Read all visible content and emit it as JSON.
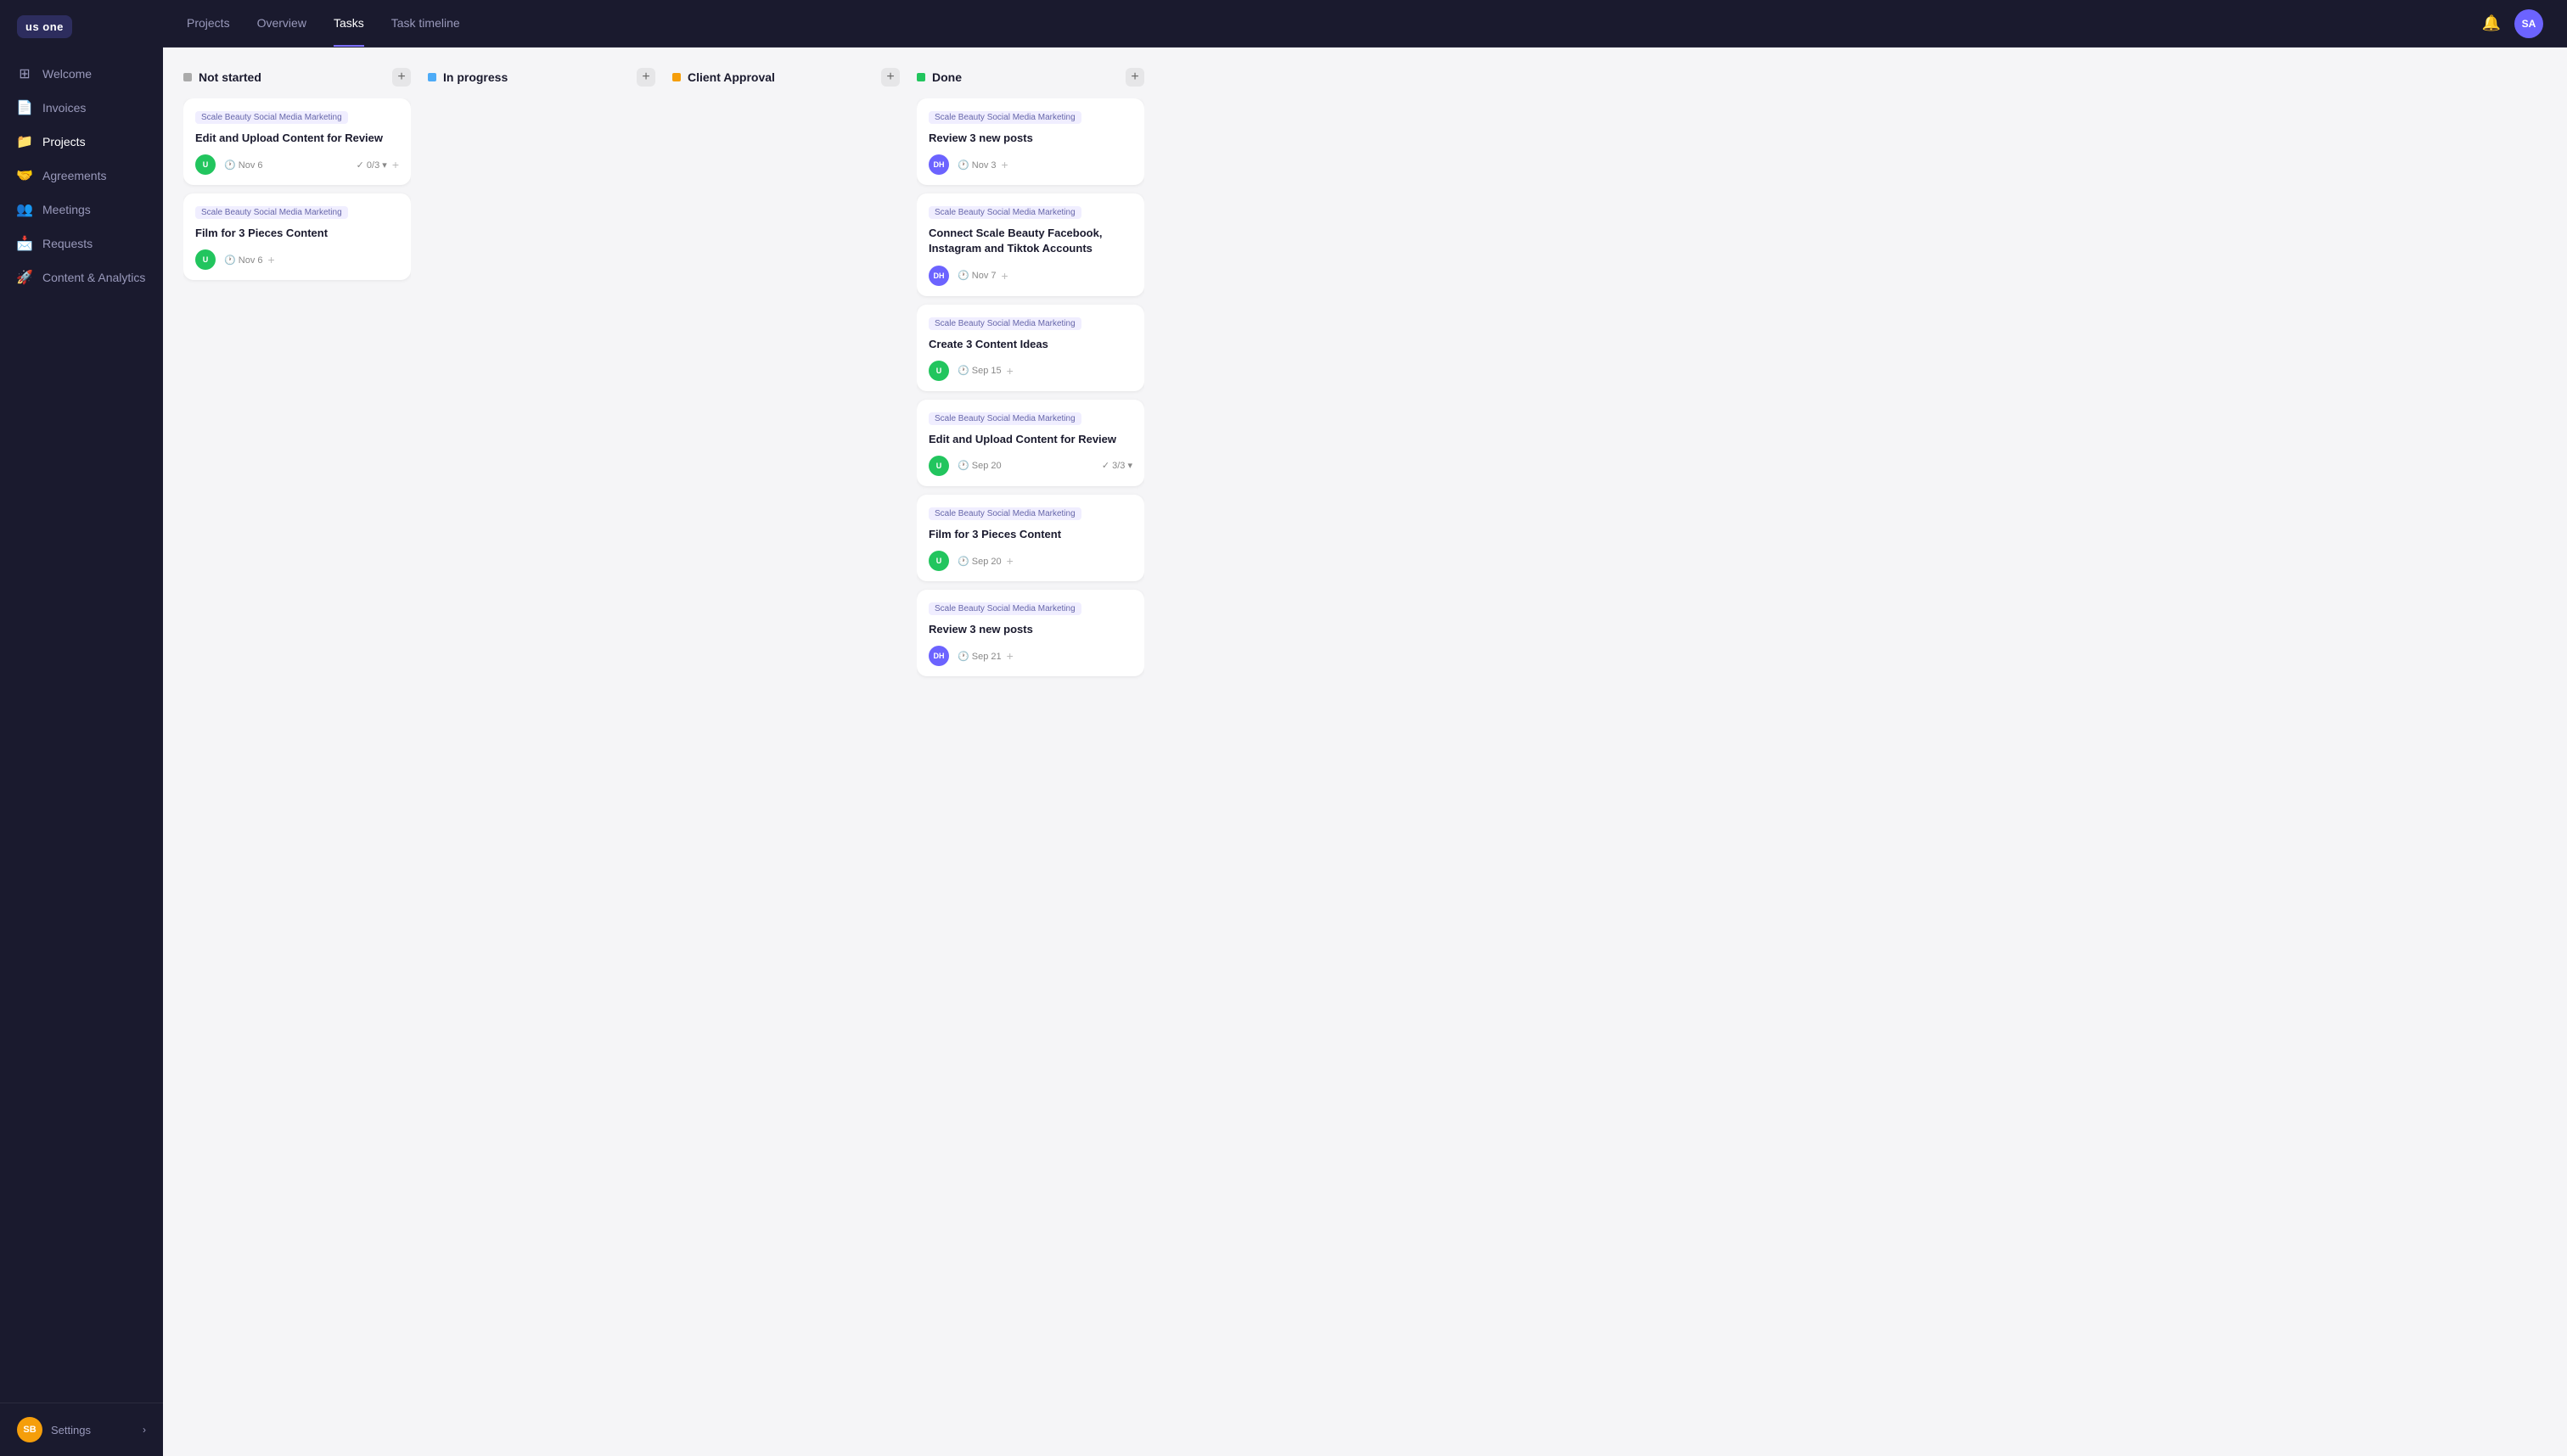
{
  "app": {
    "logo": "us one",
    "logo_sub": ""
  },
  "topnav": {
    "items": [
      {
        "label": "Projects",
        "active": false
      },
      {
        "label": "Overview",
        "active": false
      },
      {
        "label": "Tasks",
        "active": true
      },
      {
        "label": "Task timeline",
        "active": false
      }
    ],
    "user_initials": "SA"
  },
  "sidebar": {
    "items": [
      {
        "label": "Welcome",
        "icon": "⊞",
        "active": false
      },
      {
        "label": "Invoices",
        "icon": "📄",
        "active": false
      },
      {
        "label": "Projects",
        "icon": "📁",
        "active": true
      },
      {
        "label": "Agreements",
        "icon": "🤝",
        "active": false
      },
      {
        "label": "Meetings",
        "icon": "👥",
        "active": false
      },
      {
        "label": "Requests",
        "icon": "📩",
        "active": false
      },
      {
        "label": "Content & Analytics",
        "icon": "🚀",
        "active": false
      }
    ],
    "footer": {
      "label": "Settings",
      "initials": "SB"
    }
  },
  "board": {
    "columns": [
      {
        "id": "not-started",
        "title": "Not started",
        "dot_color": "dot-gray",
        "cards": [
          {
            "tag": "Scale Beauty Social Media Marketing",
            "title": "Edit and Upload Content for Review",
            "avatar_initials": "U",
            "avatar_color": "av-u",
            "date": "Nov 6",
            "check": "0/3",
            "has_dropdown": true,
            "has_plus": true
          },
          {
            "tag": "Scale Beauty Social Media Marketing",
            "title": "Film for 3 Pieces Content",
            "avatar_initials": "U",
            "avatar_color": "av-u",
            "date": "Nov 6",
            "check": "",
            "has_dropdown": false,
            "has_plus": true
          }
        ]
      },
      {
        "id": "in-progress",
        "title": "In progress",
        "dot_color": "dot-blue",
        "cards": []
      },
      {
        "id": "client-approval",
        "title": "Client Approval",
        "dot_color": "dot-orange",
        "cards": []
      },
      {
        "id": "done",
        "title": "Done",
        "dot_color": "dot-green",
        "cards": [
          {
            "tag": "Scale Beauty Social Media Marketing",
            "title": "Review 3 new posts",
            "avatar_initials": "DH",
            "avatar_color": "av-dh",
            "date": "Nov 3",
            "check": "",
            "has_dropdown": false,
            "has_plus": true
          },
          {
            "tag": "Scale Beauty Social Media Marketing",
            "title": "Connect Scale Beauty Facebook, Instagram and Tiktok Accounts",
            "avatar_initials": "DH",
            "avatar_color": "av-dh",
            "date": "Nov 7",
            "check": "",
            "has_dropdown": false,
            "has_plus": true
          },
          {
            "tag": "Scale Beauty Social Media Marketing",
            "title": "Create 3 Content Ideas",
            "avatar_initials": "U",
            "avatar_color": "av-u",
            "date": "Sep 15",
            "check": "",
            "has_dropdown": false,
            "has_plus": true
          },
          {
            "tag": "Scale Beauty Social Media Marketing",
            "title": "Edit and Upload Content for Review",
            "avatar_initials": "U",
            "avatar_color": "av-u",
            "date": "Sep 20",
            "check": "3/3",
            "has_dropdown": true,
            "has_plus": false
          },
          {
            "tag": "Scale Beauty Social Media Marketing",
            "title": "Film for 3 Pieces Content",
            "avatar_initials": "U",
            "avatar_color": "av-u",
            "date": "Sep 20",
            "check": "",
            "has_dropdown": false,
            "has_plus": true
          },
          {
            "tag": "Scale Beauty Social Media Marketing",
            "title": "Review 3 new posts",
            "avatar_initials": "DH",
            "avatar_color": "av-dh",
            "date": "Sep 21",
            "check": "",
            "has_dropdown": false,
            "has_plus": true
          }
        ]
      }
    ]
  }
}
